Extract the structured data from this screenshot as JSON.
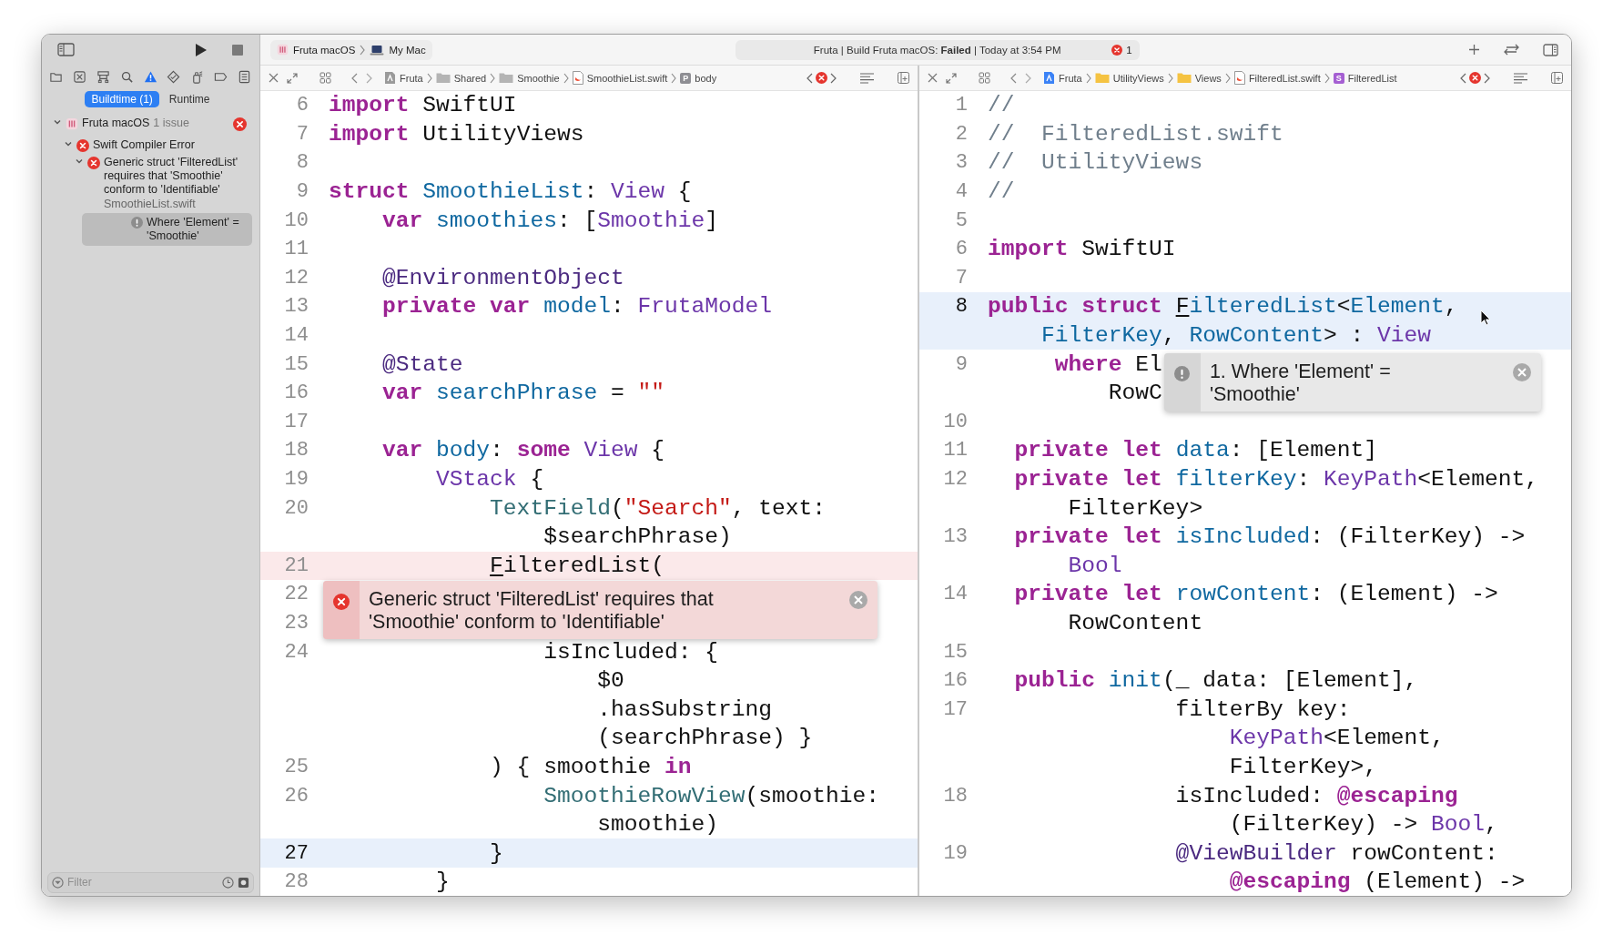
{
  "toolbar": {
    "scheme": "Fruta macOS",
    "destination": "My Mac",
    "activity": "Fruta | Build Fruta macOS: **Failed** | Today at 3:54 PM",
    "error_count": "1"
  },
  "navigator": {
    "tabs": [
      {
        "selected": false
      },
      {
        "selected": false
      },
      {
        "selected": false
      },
      {
        "selected": false
      },
      {
        "selected": true
      },
      {
        "selected": false
      },
      {
        "selected": false
      },
      {
        "selected": false
      },
      {
        "selected": false
      }
    ],
    "modes": [
      {
        "label": "Buildtime (1)",
        "selected": true
      },
      {
        "label": "Runtime",
        "selected": false
      }
    ],
    "tree": [
      {
        "kind": "target",
        "label": "Fruta macOS",
        "detail": "1 issue",
        "failed": true,
        "expanded": true,
        "selected": false,
        "children": [
          {
            "kind": "error",
            "label": "Swift Compiler Error",
            "expanded": true,
            "selected": false,
            "children": [
              {
                "kind": "error",
                "label": "Generic struct 'FilteredList' requires that 'Smoothie' conform to 'Identifiable'",
                "file": "SmoothieList.swift",
                "expanded": true,
                "selected": false,
                "children": [
                  {
                    "kind": "note",
                    "label": "Where 'Element' = 'Smoothie'",
                    "selected": true
                  }
                ]
              }
            ]
          }
        ]
      }
    ],
    "filter": {
      "placeholder": "Filter"
    }
  },
  "editors": [
    {
      "active": false,
      "breadcrumbs": [
        {
          "kind": "project",
          "label": "Fruta"
        },
        {
          "kind": "folder",
          "label": "Shared"
        },
        {
          "kind": "folder",
          "label": "Smoothie"
        },
        {
          "kind": "swift-file",
          "label": "SmoothieList.swift"
        },
        {
          "kind": "symbol",
          "badge": "P",
          "color": "#8e8e93",
          "label": "body"
        }
      ],
      "rows": [
        {
          "number": "6",
          "tokens": [
            {
              "kind": "keyword",
              "text": "import"
            },
            {
              "kind": "plain",
              "text": " SwiftUI"
            }
          ]
        },
        {
          "number": "7",
          "tokens": [
            {
              "kind": "keyword",
              "text": "import"
            },
            {
              "kind": "plain",
              "text": " UtilityViews"
            }
          ]
        },
        {
          "number": "8",
          "tokens": []
        },
        {
          "number": "9",
          "tokens": [
            {
              "kind": "keyword",
              "text": "struct "
            },
            {
              "kind": "declaration",
              "text": "SmoothieList"
            },
            {
              "kind": "plain",
              "text": ": "
            },
            {
              "kind": "type",
              "text": "View"
            },
            {
              "kind": "plain",
              "text": " {"
            }
          ]
        },
        {
          "number": "10",
          "tokens": [
            {
              "kind": "keyword",
              "text": "    var "
            },
            {
              "kind": "declaration",
              "text": "smoothies"
            },
            {
              "kind": "plain",
              "text": ": ["
            },
            {
              "kind": "type",
              "text": "Smoothie"
            },
            {
              "kind": "plain",
              "text": "]"
            }
          ]
        },
        {
          "number": "11",
          "tokens": []
        },
        {
          "number": "12",
          "tokens": [
            {
              "kind": "attribute",
              "text": "    @EnvironmentObject"
            }
          ]
        },
        {
          "number": "13",
          "tokens": [
            {
              "kind": "keyword",
              "text": "    private var "
            },
            {
              "kind": "declaration",
              "text": "model"
            },
            {
              "kind": "plain",
              "text": ": "
            },
            {
              "kind": "type",
              "text": "FrutaModel"
            }
          ]
        },
        {
          "number": "14",
          "tokens": []
        },
        {
          "number": "15",
          "tokens": [
            {
              "kind": "attribute",
              "text": "    @State"
            }
          ]
        },
        {
          "number": "16",
          "tokens": [
            {
              "kind": "keyword",
              "text": "    var "
            },
            {
              "kind": "declaration",
              "text": "searchPhrase"
            },
            {
              "kind": "plain",
              "text": " = "
            },
            {
              "kind": "string",
              "text": "\"\""
            }
          ]
        },
        {
          "number": "17",
          "tokens": []
        },
        {
          "number": "18",
          "tokens": [
            {
              "kind": "keyword",
              "text": "    var "
            },
            {
              "kind": "declaration",
              "text": "body"
            },
            {
              "kind": "plain",
              "text": ": "
            },
            {
              "kind": "keyword",
              "text": "some "
            },
            {
              "kind": "type",
              "text": "View"
            },
            {
              "kind": "plain",
              "text": " {"
            }
          ]
        },
        {
          "number": "19",
          "tokens": [
            {
              "kind": "type",
              "text": "        VStack"
            },
            {
              "kind": "plain",
              "text": " {"
            }
          ]
        },
        {
          "number": "20",
          "tokens": [
            {
              "kind": "call",
              "text": "            TextField"
            },
            {
              "kind": "plain",
              "text": "("
            },
            {
              "kind": "string",
              "text": "\"Search\""
            },
            {
              "kind": "plain",
              "text": ", text:"
            }
          ]
        },
        {
          "tokens": [
            {
              "kind": "plain",
              "text": "                $searchPhrase)"
            }
          ]
        },
        {
          "number": "21",
          "error_line": true,
          "tokens": [
            {
              "kind": "issue",
              "text": "            F"
            },
            {
              "kind": "plain",
              "text": "ilteredList("
            }
          ]
        },
        {
          "number": "22",
          "tokens": [],
          "popup": {
            "kind": "error",
            "text": "Generic struct 'FilteredList' requires that 'Smoothie' conform to 'Identifiable'"
          }
        },
        {
          "number": "23",
          "tokens": []
        },
        {
          "number": "24",
          "tokens": [
            {
              "kind": "plain",
              "text": "                isIncluded: {"
            }
          ]
        },
        {
          "tokens": [
            {
              "kind": "plain",
              "text": "                    $0"
            }
          ]
        },
        {
          "tokens": [
            {
              "kind": "plain",
              "text": "                    .hasSubstring"
            }
          ]
        },
        {
          "tokens": [
            {
              "kind": "plain",
              "text": "                    (searchPhrase) }"
            }
          ]
        },
        {
          "number": "25",
          "tokens": [
            {
              "kind": "plain",
              "text": "            ) { smoothie "
            },
            {
              "kind": "keyword",
              "text": "in"
            }
          ]
        },
        {
          "number": "26",
          "tokens": [
            {
              "kind": "call",
              "text": "                SmoothieRowView"
            },
            {
              "kind": "plain",
              "text": "(smoothie:"
            }
          ]
        },
        {
          "tokens": [
            {
              "kind": "plain",
              "text": "                    smoothie)"
            }
          ]
        },
        {
          "number": "27",
          "current_line": true,
          "tokens": [
            {
              "kind": "plain",
              "text": "            }"
            }
          ]
        },
        {
          "number": "28",
          "tokens": [
            {
              "kind": "plain",
              "text": "        }"
            }
          ]
        }
      ]
    },
    {
      "active": true,
      "breadcrumbs": [
        {
          "kind": "project",
          "label": "Fruta"
        },
        {
          "kind": "folder",
          "label": "UtilityViews"
        },
        {
          "kind": "folder",
          "label": "Views"
        },
        {
          "kind": "swift-file",
          "label": "FilteredList.swift"
        },
        {
          "kind": "symbol",
          "badge": "S",
          "color": "#a55fd2",
          "label": "FilteredList"
        }
      ],
      "rows": [
        {
          "number": "1",
          "tokens": [
            {
              "kind": "comment",
              "text": "//"
            }
          ]
        },
        {
          "number": "2",
          "tokens": [
            {
              "kind": "comment",
              "text": "//  FilteredList.swift"
            }
          ]
        },
        {
          "number": "3",
          "tokens": [
            {
              "kind": "comment",
              "text": "//  UtilityViews"
            }
          ]
        },
        {
          "number": "4",
          "tokens": [
            {
              "kind": "comment",
              "text": "//"
            }
          ]
        },
        {
          "number": "5",
          "tokens": []
        },
        {
          "number": "6",
          "tokens": [
            {
              "kind": "keyword",
              "text": "import"
            },
            {
              "kind": "plain",
              "text": " SwiftUI"
            }
          ]
        },
        {
          "number": "7",
          "tokens": []
        },
        {
          "number": "8",
          "current_line": true,
          "tokens": [
            {
              "kind": "keyword",
              "text": "public struct "
            },
            {
              "kind": "issue",
              "text": "F"
            },
            {
              "kind": "declaration",
              "text": "ilteredList"
            },
            {
              "kind": "plain",
              "text": "<"
            },
            {
              "kind": "declaration",
              "text": "Element"
            },
            {
              "kind": "plain",
              "text": ","
            }
          ]
        },
        {
          "current_line": true,
          "tokens": [
            {
              "kind": "declaration",
              "text": "    FilterKey"
            },
            {
              "kind": "plain",
              "text": ", "
            },
            {
              "kind": "declaration",
              "text": "RowContent"
            },
            {
              "kind": "plain",
              "text": "> : "
            },
            {
              "kind": "type",
              "text": "View"
            }
          ]
        },
        {
          "number": "9",
          "tokens": [
            {
              "kind": "keyword",
              "text": "     where"
            },
            {
              "kind": "plain",
              "text": " El"
            }
          ],
          "popup": {
            "kind": "note",
            "text": "1. Where 'Element' = 'Smoothie'"
          }
        },
        {
          "tokens": [
            {
              "kind": "plain",
              "text": "         RowC"
            }
          ]
        },
        {
          "number": "10",
          "tokens": []
        },
        {
          "number": "11",
          "tokens": [
            {
              "kind": "keyword",
              "text": "  private let "
            },
            {
              "kind": "declaration",
              "text": "data"
            },
            {
              "kind": "plain",
              "text": ": [Element]"
            }
          ]
        },
        {
          "number": "12",
          "tokens": [
            {
              "kind": "keyword",
              "text": "  private let "
            },
            {
              "kind": "declaration",
              "text": "filterKey"
            },
            {
              "kind": "plain",
              "text": ": "
            },
            {
              "kind": "type",
              "text": "KeyPath"
            },
            {
              "kind": "plain",
              "text": "<Element,"
            }
          ]
        },
        {
          "tokens": [
            {
              "kind": "plain",
              "text": "      FilterKey>"
            }
          ]
        },
        {
          "number": "13",
          "tokens": [
            {
              "kind": "keyword",
              "text": "  private let "
            },
            {
              "kind": "declaration",
              "text": "isIncluded"
            },
            {
              "kind": "plain",
              "text": ": (FilterKey) ->"
            }
          ]
        },
        {
          "tokens": [
            {
              "kind": "type",
              "text": "      Bool"
            }
          ]
        },
        {
          "number": "14",
          "tokens": [
            {
              "kind": "keyword",
              "text": "  private let "
            },
            {
              "kind": "declaration",
              "text": "rowContent"
            },
            {
              "kind": "plain",
              "text": ": (Element) ->"
            }
          ]
        },
        {
          "tokens": [
            {
              "kind": "plain",
              "text": "      RowContent"
            }
          ]
        },
        {
          "number": "15",
          "tokens": []
        },
        {
          "number": "16",
          "tokens": [
            {
              "kind": "keyword",
              "text": "  public "
            },
            {
              "kind": "declaration",
              "text": "init"
            },
            {
              "kind": "plain",
              "text": "(_ data: [Element],"
            }
          ]
        },
        {
          "number": "17",
          "tokens": [
            {
              "kind": "plain",
              "text": "              filterBy key:"
            }
          ]
        },
        {
          "tokens": [
            {
              "kind": "type",
              "text": "                  KeyPath"
            },
            {
              "kind": "plain",
              "text": "<Element,"
            }
          ]
        },
        {
          "tokens": [
            {
              "kind": "plain",
              "text": "                  FilterKey>,"
            }
          ]
        },
        {
          "number": "18",
          "tokens": [
            {
              "kind": "plain",
              "text": "              isIncluded: "
            },
            {
              "kind": "keyword",
              "text": "@escaping"
            }
          ]
        },
        {
          "tokens": [
            {
              "kind": "plain",
              "text": "                  (FilterKey) -> "
            },
            {
              "kind": "type",
              "text": "Bool"
            },
            {
              "kind": "plain",
              "text": ","
            }
          ]
        },
        {
          "number": "19",
          "tokens": [
            {
              "kind": "attribute",
              "text": "              @ViewBuilder"
            },
            {
              "kind": "plain",
              "text": " rowContent:"
            }
          ]
        },
        {
          "tokens": [
            {
              "kind": "keyword",
              "text": "                  @escaping"
            },
            {
              "kind": "plain",
              "text": " (Element) ->"
            }
          ]
        }
      ]
    }
  ]
}
